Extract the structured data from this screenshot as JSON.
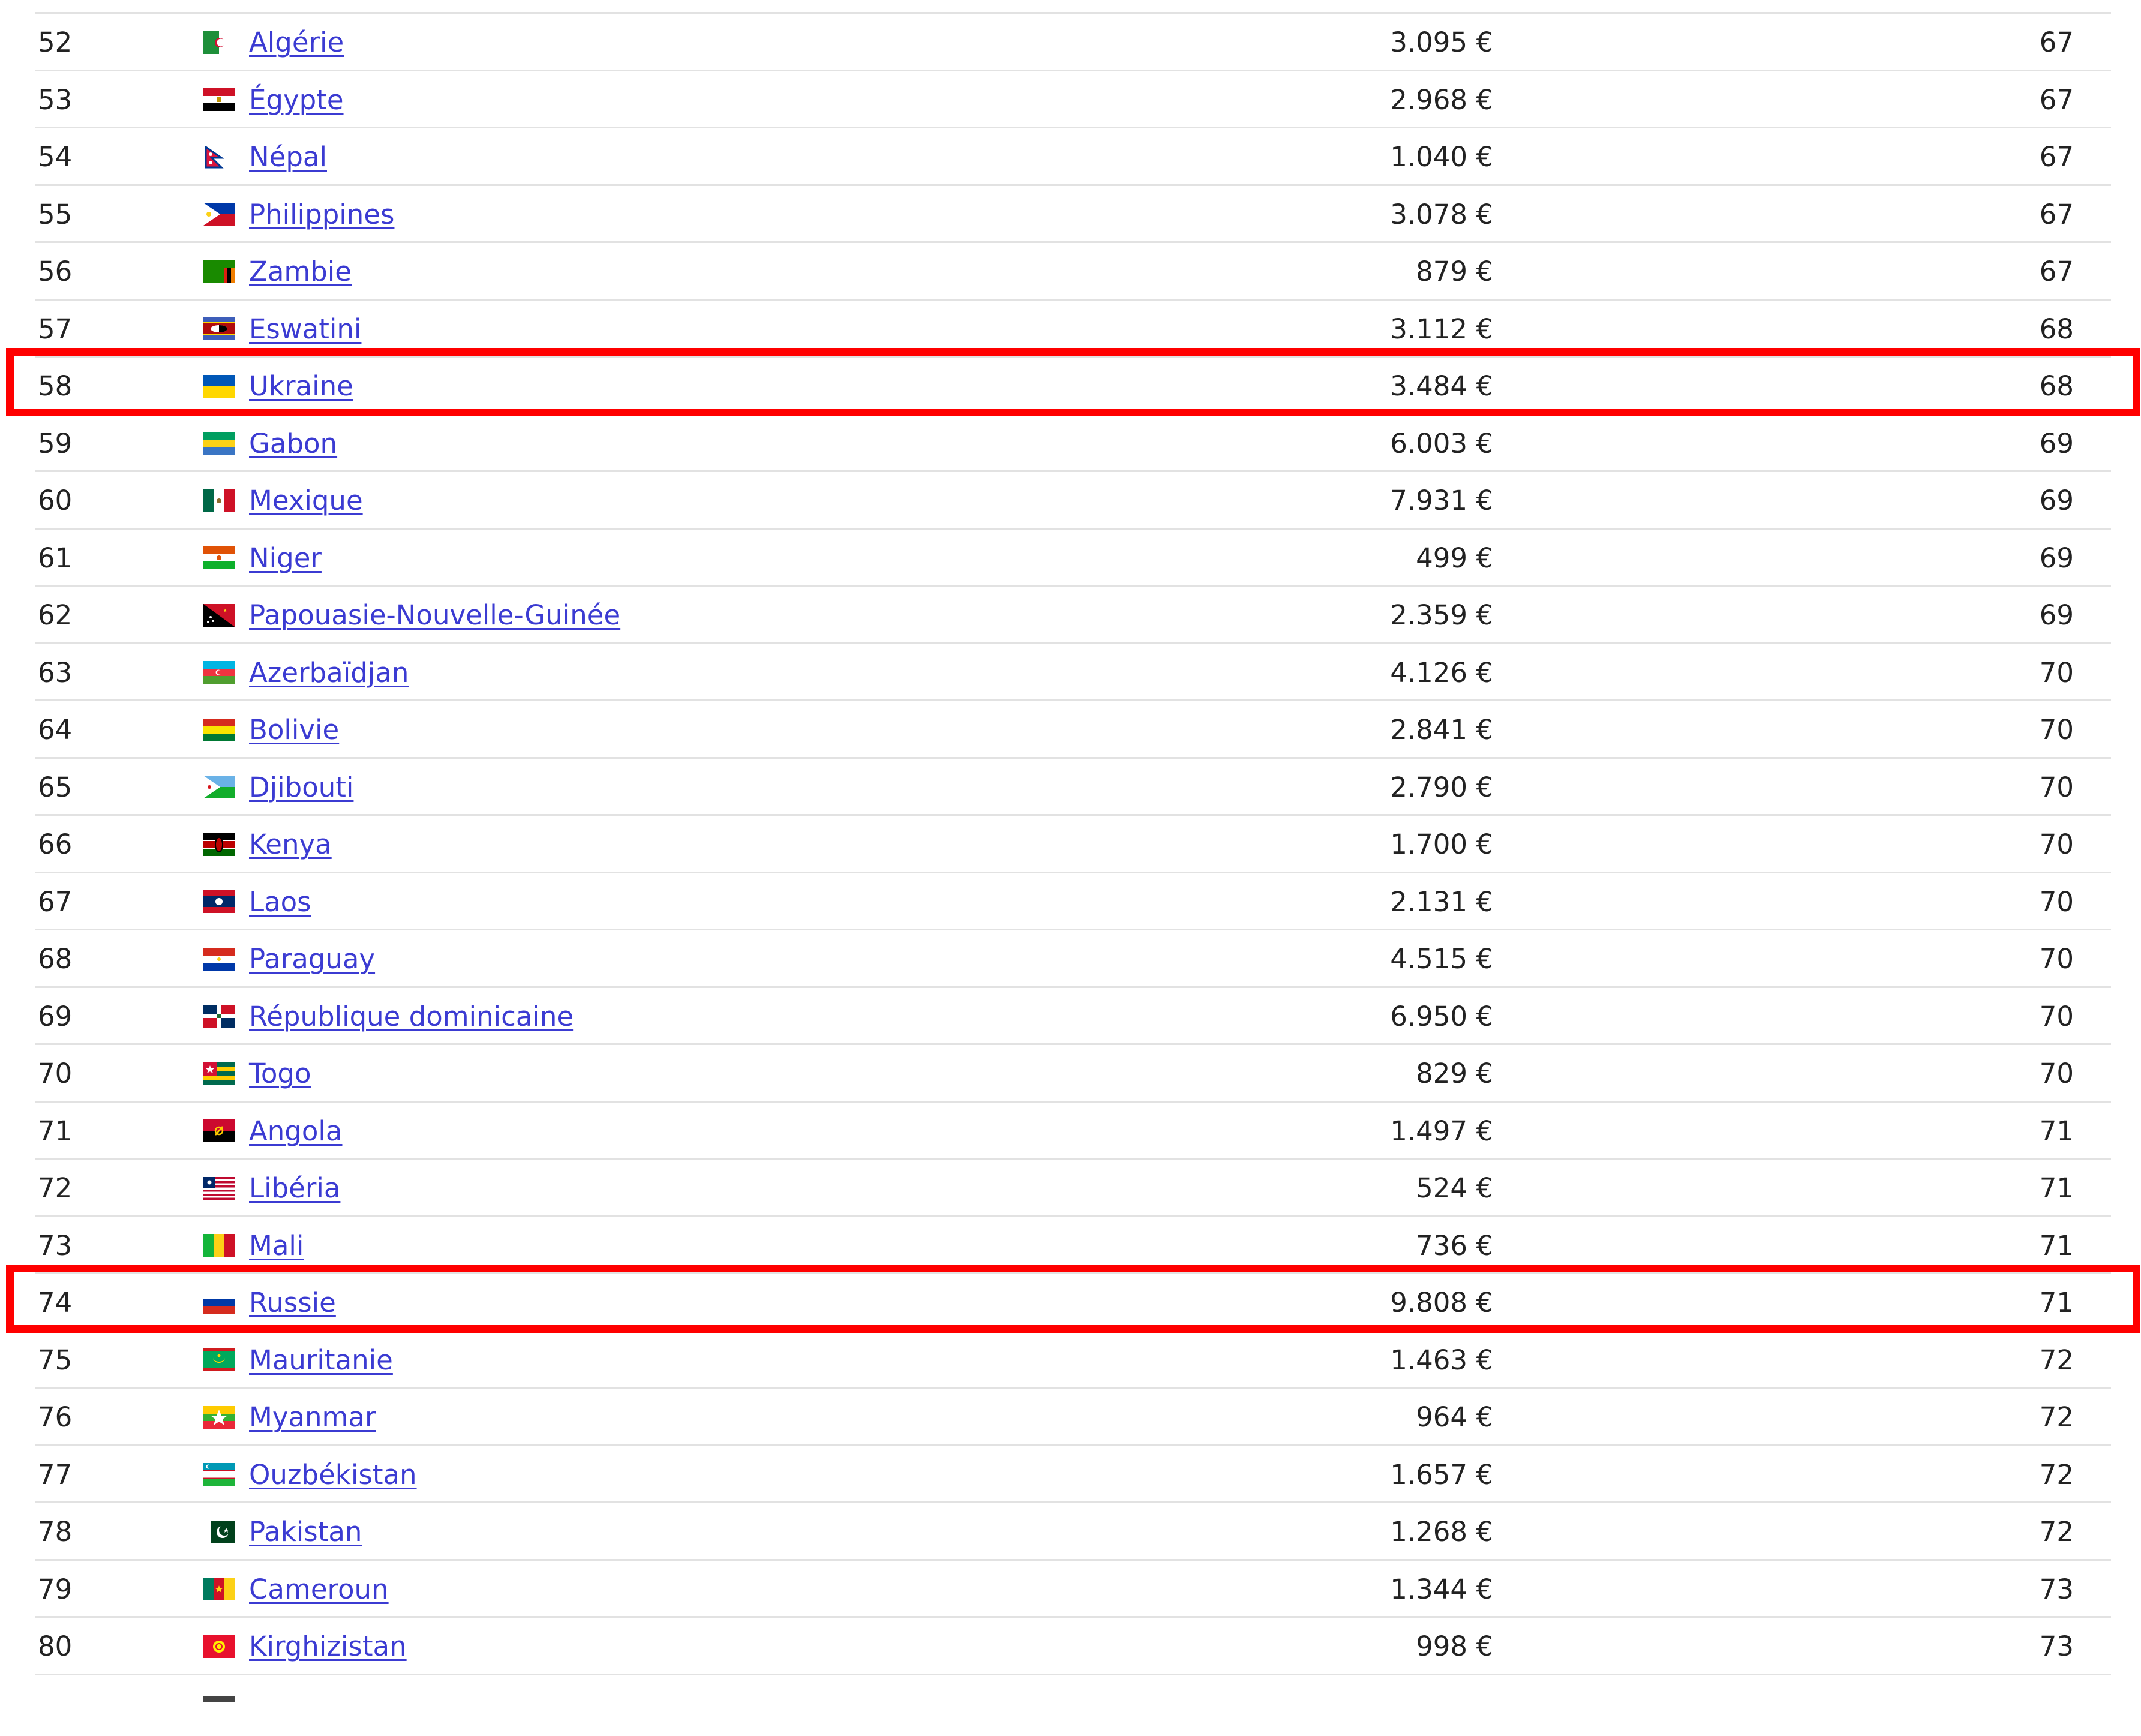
{
  "table": {
    "rows": [
      {
        "rank": "52",
        "country": "Algérie",
        "value": "3.095 €",
        "score": "67",
        "flag": "algeria-flag-icon",
        "highlighted": false
      },
      {
        "rank": "53",
        "country": "Égypte",
        "value": "2.968 €",
        "score": "67",
        "flag": "egypt-flag-icon",
        "highlighted": false
      },
      {
        "rank": "54",
        "country": "Népal",
        "value": "1.040 €",
        "score": "67",
        "flag": "nepal-flag-icon",
        "highlighted": false
      },
      {
        "rank": "55",
        "country": "Philippines",
        "value": "3.078 €",
        "score": "67",
        "flag": "philippines-flag-icon",
        "highlighted": false
      },
      {
        "rank": "56",
        "country": "Zambie",
        "value": "879 €",
        "score": "67",
        "flag": "zambia-flag-icon",
        "highlighted": false
      },
      {
        "rank": "57",
        "country": "Eswatini",
        "value": "3.112 €",
        "score": "68",
        "flag": "eswatini-flag-icon",
        "highlighted": false
      },
      {
        "rank": "58",
        "country": "Ukraine",
        "value": "3.484 €",
        "score": "68",
        "flag": "ukraine-flag-icon",
        "highlighted": true
      },
      {
        "rank": "59",
        "country": "Gabon",
        "value": "6.003 €",
        "score": "69",
        "flag": "gabon-flag-icon",
        "highlighted": false
      },
      {
        "rank": "60",
        "country": "Mexique",
        "value": "7.931 €",
        "score": "69",
        "flag": "mexico-flag-icon",
        "highlighted": false
      },
      {
        "rank": "61",
        "country": "Niger",
        "value": "499 €",
        "score": "69",
        "flag": "niger-flag-icon",
        "highlighted": false
      },
      {
        "rank": "62",
        "country": "Papouasie-Nouvelle-Guinée",
        "value": "2.359 €",
        "score": "69",
        "flag": "papua-new-guinea-flag-icon",
        "highlighted": false
      },
      {
        "rank": "63",
        "country": "Azerbaïdjan",
        "value": "4.126 €",
        "score": "70",
        "flag": "azerbaijan-flag-icon",
        "highlighted": false
      },
      {
        "rank": "64",
        "country": "Bolivie",
        "value": "2.841 €",
        "score": "70",
        "flag": "bolivia-flag-icon",
        "highlighted": false
      },
      {
        "rank": "65",
        "country": "Djibouti",
        "value": "2.790 €",
        "score": "70",
        "flag": "djibouti-flag-icon",
        "highlighted": false
      },
      {
        "rank": "66",
        "country": "Kenya",
        "value": "1.700 €",
        "score": "70",
        "flag": "kenya-flag-icon",
        "highlighted": false
      },
      {
        "rank": "67",
        "country": "Laos",
        "value": "2.131 €",
        "score": "70",
        "flag": "laos-flag-icon",
        "highlighted": false
      },
      {
        "rank": "68",
        "country": "Paraguay",
        "value": "4.515 €",
        "score": "70",
        "flag": "paraguay-flag-icon",
        "highlighted": false
      },
      {
        "rank": "69",
        "country": "République dominicaine",
        "value": "6.950 €",
        "score": "70",
        "flag": "dominican-republic-flag-icon",
        "highlighted": false
      },
      {
        "rank": "70",
        "country": "Togo",
        "value": "829 €",
        "score": "70",
        "flag": "togo-flag-icon",
        "highlighted": false
      },
      {
        "rank": "71",
        "country": "Angola",
        "value": "1.497 €",
        "score": "71",
        "flag": "angola-flag-icon",
        "highlighted": false
      },
      {
        "rank": "72",
        "country": "Libéria",
        "value": "524 €",
        "score": "71",
        "flag": "liberia-flag-icon",
        "highlighted": false
      },
      {
        "rank": "73",
        "country": "Mali",
        "value": "736 €",
        "score": "71",
        "flag": "mali-flag-icon",
        "highlighted": false
      },
      {
        "rank": "74",
        "country": "Russie",
        "value": "9.808 €",
        "score": "71",
        "flag": "russia-flag-icon",
        "highlighted": true
      },
      {
        "rank": "75",
        "country": "Mauritanie",
        "value": "1.463 €",
        "score": "72",
        "flag": "mauritania-flag-icon",
        "highlighted": false
      },
      {
        "rank": "76",
        "country": "Myanmar",
        "value": "964 €",
        "score": "72",
        "flag": "myanmar-flag-icon",
        "highlighted": false
      },
      {
        "rank": "77",
        "country": "Ouzbékistan",
        "value": "1.657 €",
        "score": "72",
        "flag": "uzbekistan-flag-icon",
        "highlighted": false
      },
      {
        "rank": "78",
        "country": "Pakistan",
        "value": "1.268 €",
        "score": "72",
        "flag": "pakistan-flag-icon",
        "highlighted": false
      },
      {
        "rank": "79",
        "country": "Cameroun",
        "value": "1.344 €",
        "score": "73",
        "flag": "cameroon-flag-icon",
        "highlighted": false
      },
      {
        "rank": "80",
        "country": "Kirghizistan",
        "value": "998 €",
        "score": "73",
        "flag": "kyrgyzstan-flag-icon",
        "highlighted": false
      }
    ]
  },
  "colors": {
    "link": "#3b3bd2",
    "highlight_border": "#ff0000",
    "row_divider": "#e2e2e2",
    "text": "#222222"
  }
}
